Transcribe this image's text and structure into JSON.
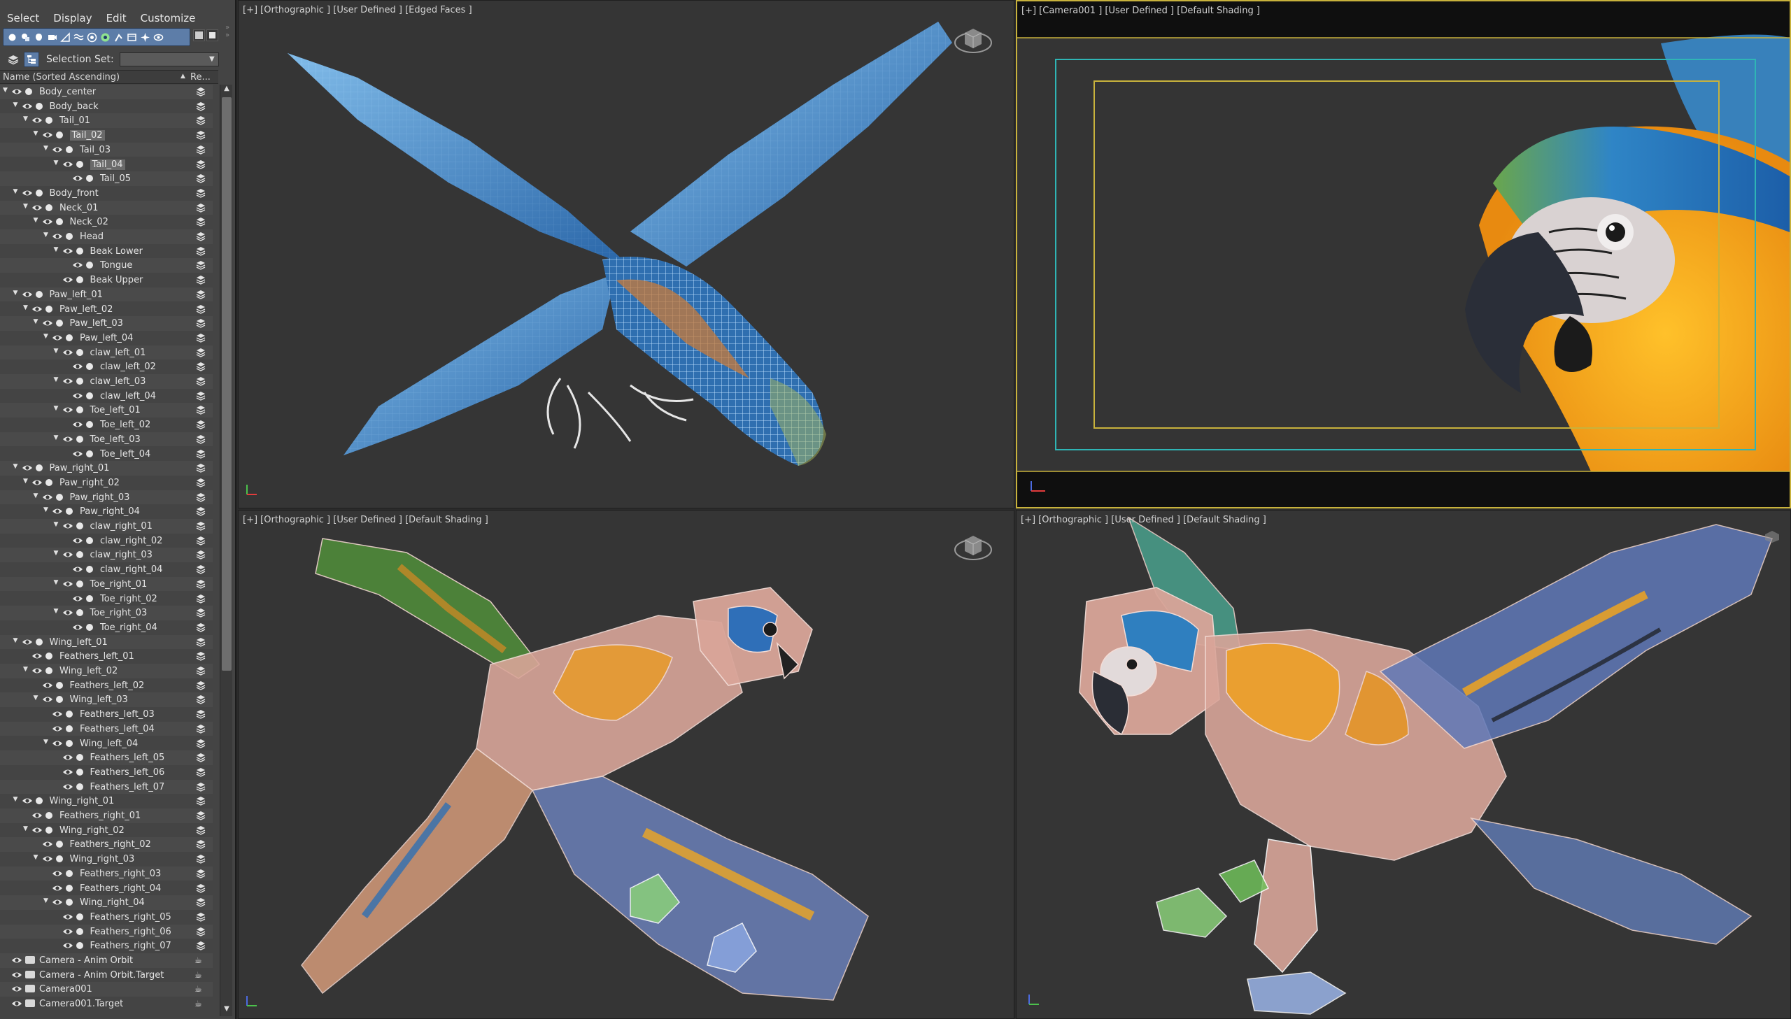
{
  "menu": [
    "Select",
    "Display",
    "Edit",
    "Customize"
  ],
  "toolbar_icons": [
    "sphere-filter-icon",
    "geometry-filter-icon",
    "light-filter-icon",
    "camera-filter-icon",
    "helper-filter-icon",
    "spacewarp-filter-icon",
    "group-filter-icon",
    "xref-filter-icon",
    "bone-filter-icon",
    "container-filter-icon",
    "frozen-filter-icon",
    "hidden-filter-icon"
  ],
  "selection_set": {
    "label": "Selection Set:",
    "value": ""
  },
  "columns": {
    "name": "Name (Sorted Ascending)",
    "sort_arrow": "▲",
    "re": "Re..."
  },
  "tree": [
    {
      "label": "Body_center",
      "depth": 0,
      "expanded": true
    },
    {
      "label": "Body_back",
      "depth": 1,
      "expanded": true
    },
    {
      "label": "Tail_01",
      "depth": 2,
      "expanded": true
    },
    {
      "label": "Tail_02",
      "depth": 3,
      "expanded": true,
      "highlight": true
    },
    {
      "label": "Tail_03",
      "depth": 4,
      "expanded": true
    },
    {
      "label": "Tail_04",
      "depth": 5,
      "expanded": true,
      "highlight": true
    },
    {
      "label": "Tail_05",
      "depth": 6,
      "expanded": false
    },
    {
      "label": "Body_front",
      "depth": 1,
      "expanded": true
    },
    {
      "label": "Neck_01",
      "depth": 2,
      "expanded": true
    },
    {
      "label": "Neck_02",
      "depth": 3,
      "expanded": true
    },
    {
      "label": "Head",
      "depth": 4,
      "expanded": true
    },
    {
      "label": "Beak Lower",
      "depth": 5,
      "expanded": true
    },
    {
      "label": "Tongue",
      "depth": 6,
      "expanded": false
    },
    {
      "label": "Beak Upper",
      "depth": 5,
      "expanded": false
    },
    {
      "label": "Paw_left_01",
      "depth": 1,
      "expanded": true
    },
    {
      "label": "Paw_left_02",
      "depth": 2,
      "expanded": true
    },
    {
      "label": "Paw_left_03",
      "depth": 3,
      "expanded": true
    },
    {
      "label": "Paw_left_04",
      "depth": 4,
      "expanded": true
    },
    {
      "label": "claw_left_01",
      "depth": 5,
      "expanded": true
    },
    {
      "label": "claw_left_02",
      "depth": 6,
      "expanded": false
    },
    {
      "label": "claw_left_03",
      "depth": 5,
      "expanded": true
    },
    {
      "label": "claw_left_04",
      "depth": 6,
      "expanded": false
    },
    {
      "label": "Toe_left_01",
      "depth": 5,
      "expanded": true
    },
    {
      "label": "Toe_left_02",
      "depth": 6,
      "expanded": false
    },
    {
      "label": "Toe_left_03",
      "depth": 5,
      "expanded": true
    },
    {
      "label": "Toe_left_04",
      "depth": 6,
      "expanded": false
    },
    {
      "label": "Paw_right_01",
      "depth": 1,
      "expanded": true
    },
    {
      "label": "Paw_right_02",
      "depth": 2,
      "expanded": true
    },
    {
      "label": "Paw_right_03",
      "depth": 3,
      "expanded": true
    },
    {
      "label": "Paw_right_04",
      "depth": 4,
      "expanded": true
    },
    {
      "label": "claw_right_01",
      "depth": 5,
      "expanded": true
    },
    {
      "label": "claw_right_02",
      "depth": 6,
      "expanded": false
    },
    {
      "label": "claw_right_03",
      "depth": 5,
      "expanded": true
    },
    {
      "label": "claw_right_04",
      "depth": 6,
      "expanded": false
    },
    {
      "label": "Toe_right_01",
      "depth": 5,
      "expanded": true
    },
    {
      "label": "Toe_right_02",
      "depth": 6,
      "expanded": false
    },
    {
      "label": "Toe_right_03",
      "depth": 5,
      "expanded": true
    },
    {
      "label": "Toe_right_04",
      "depth": 6,
      "expanded": false
    },
    {
      "label": "Wing_left_01",
      "depth": 1,
      "expanded": true
    },
    {
      "label": "Feathers_left_01",
      "depth": 2,
      "expanded": false
    },
    {
      "label": "Wing_left_02",
      "depth": 2,
      "expanded": true
    },
    {
      "label": "Feathers_left_02",
      "depth": 3,
      "expanded": false
    },
    {
      "label": "Wing_left_03",
      "depth": 3,
      "expanded": true
    },
    {
      "label": "Feathers_left_03",
      "depth": 4,
      "expanded": false
    },
    {
      "label": "Feathers_left_04",
      "depth": 4,
      "expanded": false
    },
    {
      "label": "Wing_left_04",
      "depth": 4,
      "expanded": true
    },
    {
      "label": "Feathers_left_05",
      "depth": 5,
      "expanded": false
    },
    {
      "label": "Feathers_left_06",
      "depth": 5,
      "expanded": false
    },
    {
      "label": "Feathers_left_07",
      "depth": 5,
      "expanded": false
    },
    {
      "label": "Wing_right_01",
      "depth": 1,
      "expanded": true
    },
    {
      "label": "Feathers_right_01",
      "depth": 2,
      "expanded": false
    },
    {
      "label": "Wing_right_02",
      "depth": 2,
      "expanded": true
    },
    {
      "label": "Feathers_right_02",
      "depth": 3,
      "expanded": false
    },
    {
      "label": "Wing_right_03",
      "depth": 3,
      "expanded": true
    },
    {
      "label": "Feathers_right_03",
      "depth": 4,
      "expanded": false
    },
    {
      "label": "Feathers_right_04",
      "depth": 4,
      "expanded": false
    },
    {
      "label": "Wing_right_04",
      "depth": 4,
      "expanded": true
    },
    {
      "label": "Feathers_right_05",
      "depth": 5,
      "expanded": false
    },
    {
      "label": "Feathers_right_06",
      "depth": 5,
      "expanded": false
    },
    {
      "label": "Feathers_right_07",
      "depth": 5,
      "expanded": false
    },
    {
      "label": "Camera - Anim Orbit",
      "depth": 0,
      "expanded": false,
      "camera": true
    },
    {
      "label": "Camera - Anim Orbit.Target",
      "depth": 0,
      "expanded": false,
      "camera": true
    },
    {
      "label": "Camera001",
      "depth": 0,
      "expanded": false,
      "camera": true
    },
    {
      "label": "Camera001.Target",
      "depth": 0,
      "expanded": false,
      "camera": true
    }
  ],
  "viewports": {
    "top_left": {
      "label": "[+] [Orthographic ] [User Defined ] [Edged Faces ]"
    },
    "top_right": {
      "label": "[+] [Camera001 ] [User Defined ] [Default Shading ]",
      "active": true
    },
    "bottom_left": {
      "label": "[+] [Orthographic ] [User Defined ] [Default Shading ]"
    },
    "bottom_right": {
      "label": "[+] [Orthographic ] [User Defined ] [Default Shading ]"
    }
  },
  "colors": {
    "panel_bg": "#444444",
    "viewport_bg": "#353535",
    "active_border": "#c8b23c",
    "toolbar_accent": "#5d7da8",
    "safe_frame_outer": "#2fb5b5",
    "safe_frame_inner": "#c8b23c",
    "wire_blue": "#6fb8f0",
    "plumage_blue": "#2e78c8",
    "plumage_yellow": "#f4a820"
  }
}
